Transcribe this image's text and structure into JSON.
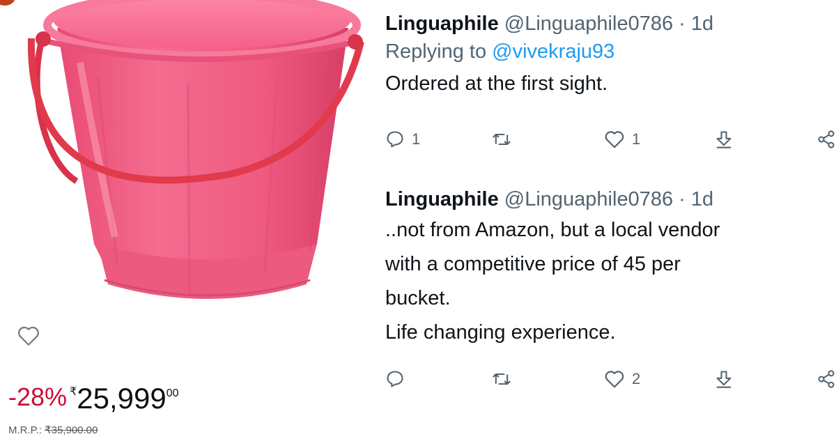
{
  "product": {
    "discount": "-28%",
    "currency_symbol": "₹",
    "price_whole": "25,999",
    "price_fraction": "00",
    "mrp_label": "M.R.P.:",
    "mrp_value": "₹35,900.00",
    "colors": {
      "bucket": "#f0577f",
      "handle": "#e03a4c",
      "discount": "#cc0c39"
    },
    "icons": {
      "wishlist": "heart-outline-icon"
    }
  },
  "tweets": [
    {
      "display_name": "Linguaphile",
      "handle": "@Linguaphile0786",
      "separator": "·",
      "time": "1d",
      "replying_to_label": "Replying to",
      "replying_to_handle": "@vivekraju93",
      "lines": [
        "Ordered at the first sight."
      ],
      "actions": {
        "replies": "1",
        "retweets": "",
        "likes": "1"
      }
    },
    {
      "display_name": "Linguaphile",
      "handle": "@Linguaphile0786",
      "separator": "·",
      "time": "1d",
      "lines": [
        "..not from Amazon, but a local vendor",
        "with a competitive price of 45 per",
        "bucket.",
        "Life changing experience."
      ],
      "actions": {
        "replies": "",
        "retweets": "",
        "likes": "2"
      }
    }
  ],
  "theme": {
    "text": "#0f1419",
    "muted": "#536471",
    "link": "#1d9bf0"
  }
}
